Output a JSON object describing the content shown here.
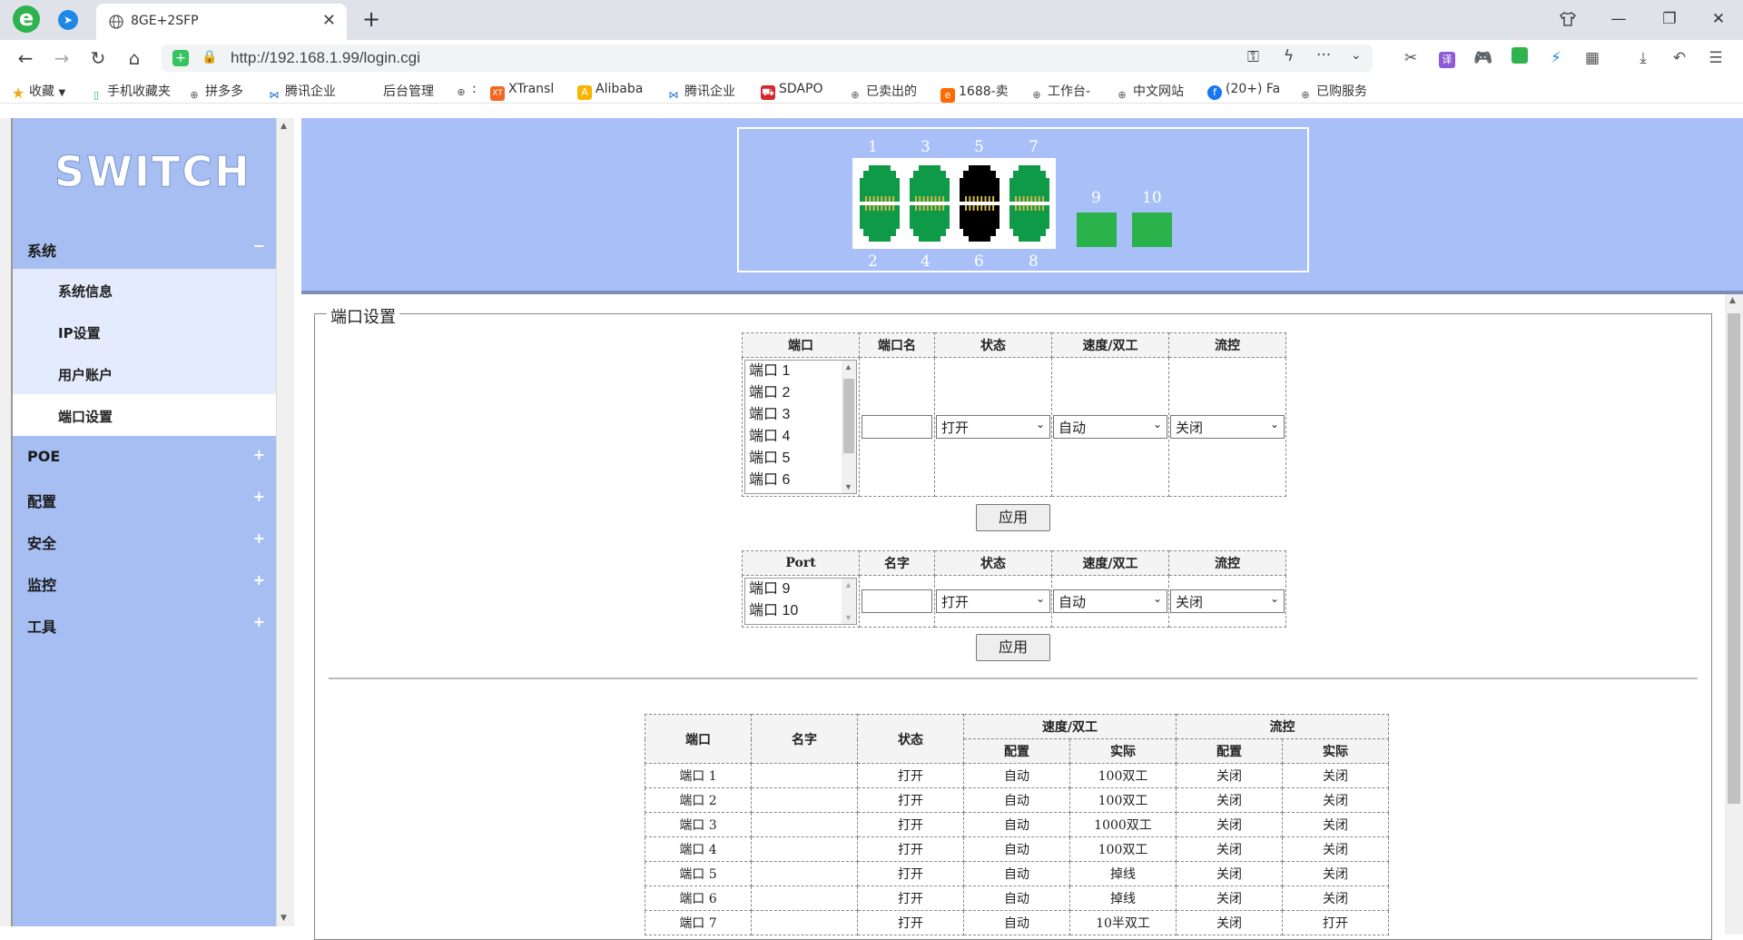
{
  "browser": {
    "tab_title": "8GE+2SFP",
    "url": "http://192.168.1.99/login.cgi",
    "bookmarks": [
      "收藏",
      "手机收藏夹",
      "拼多多",
      "腾讯企业",
      "后台管理",
      ":",
      "XTransl",
      "Alibaba",
      "腾讯企业",
      "SDAPO",
      "已卖出的",
      "1688-卖",
      "工作台-",
      "中文网站",
      "(20+) Fa",
      "已购服务"
    ]
  },
  "sidebar": {
    "logo": "SWITCH",
    "menu": [
      {
        "label": "系统",
        "sign": "−"
      },
      {
        "label": "POE",
        "sign": "+"
      },
      {
        "label": "配置",
        "sign": "+"
      },
      {
        "label": "安全",
        "sign": "+"
      },
      {
        "label": "监控",
        "sign": "+"
      },
      {
        "label": "工具",
        "sign": "+"
      }
    ],
    "submenu": [
      "系统信息",
      "IP设置",
      "用户账户",
      "端口设置"
    ]
  },
  "ports_panel": {
    "top_numbers": [
      "1",
      "3",
      "5",
      "7"
    ],
    "bottom_numbers": [
      "2",
      "4",
      "6",
      "8"
    ],
    "sfp_numbers": [
      "9",
      "10"
    ],
    "colors": {
      "up": "#0f9a48",
      "down": "#000000",
      "sfp": "#29b34a"
    }
  },
  "section_title": "端口设置",
  "config1": {
    "headers": [
      "端口",
      "端口名",
      "状态",
      "速度/双工",
      "流控"
    ],
    "ports": [
      "端口 1",
      "端口 2",
      "端口 3",
      "端口 4",
      "端口 5",
      "端口 6"
    ],
    "state": "打开",
    "speed": "自动",
    "flow": "关闭",
    "apply": "应用"
  },
  "config2": {
    "headers": [
      "Port",
      "名字",
      "状态",
      "速度/双工",
      "流控"
    ],
    "ports": [
      "端口 9",
      "端口 10"
    ],
    "state": "打开",
    "speed": "自动",
    "flow": "关闭",
    "apply": "应用"
  },
  "status_table": {
    "h_port": "端口",
    "h_name": "名字",
    "h_state": "状态",
    "h_speed": "速度/双工",
    "h_flow": "流控",
    "h_cfg": "配置",
    "h_actual": "实际",
    "rows": [
      {
        "port": "端口 1",
        "name": "",
        "state": "打开",
        "speed_cfg": "自动",
        "speed_act": "100双工",
        "flow_cfg": "关闭",
        "flow_act": "关闭"
      },
      {
        "port": "端口 2",
        "name": "",
        "state": "打开",
        "speed_cfg": "自动",
        "speed_act": "100双工",
        "flow_cfg": "关闭",
        "flow_act": "关闭"
      },
      {
        "port": "端口 3",
        "name": "",
        "state": "打开",
        "speed_cfg": "自动",
        "speed_act": "1000双工",
        "flow_cfg": "关闭",
        "flow_act": "关闭"
      },
      {
        "port": "端口 4",
        "name": "",
        "state": "打开",
        "speed_cfg": "自动",
        "speed_act": "100双工",
        "flow_cfg": "关闭",
        "flow_act": "关闭"
      },
      {
        "port": "端口 5",
        "name": "",
        "state": "打开",
        "speed_cfg": "自动",
        "speed_act": "掉线",
        "flow_cfg": "关闭",
        "flow_act": "关闭"
      },
      {
        "port": "端口 6",
        "name": "",
        "state": "打开",
        "speed_cfg": "自动",
        "speed_act": "掉线",
        "flow_cfg": "关闭",
        "flow_act": "关闭"
      },
      {
        "port": "端口 7",
        "name": "",
        "state": "打开",
        "speed_cfg": "自动",
        "speed_act": "10半双工",
        "flow_cfg": "关闭",
        "flow_act": "打开"
      }
    ]
  }
}
